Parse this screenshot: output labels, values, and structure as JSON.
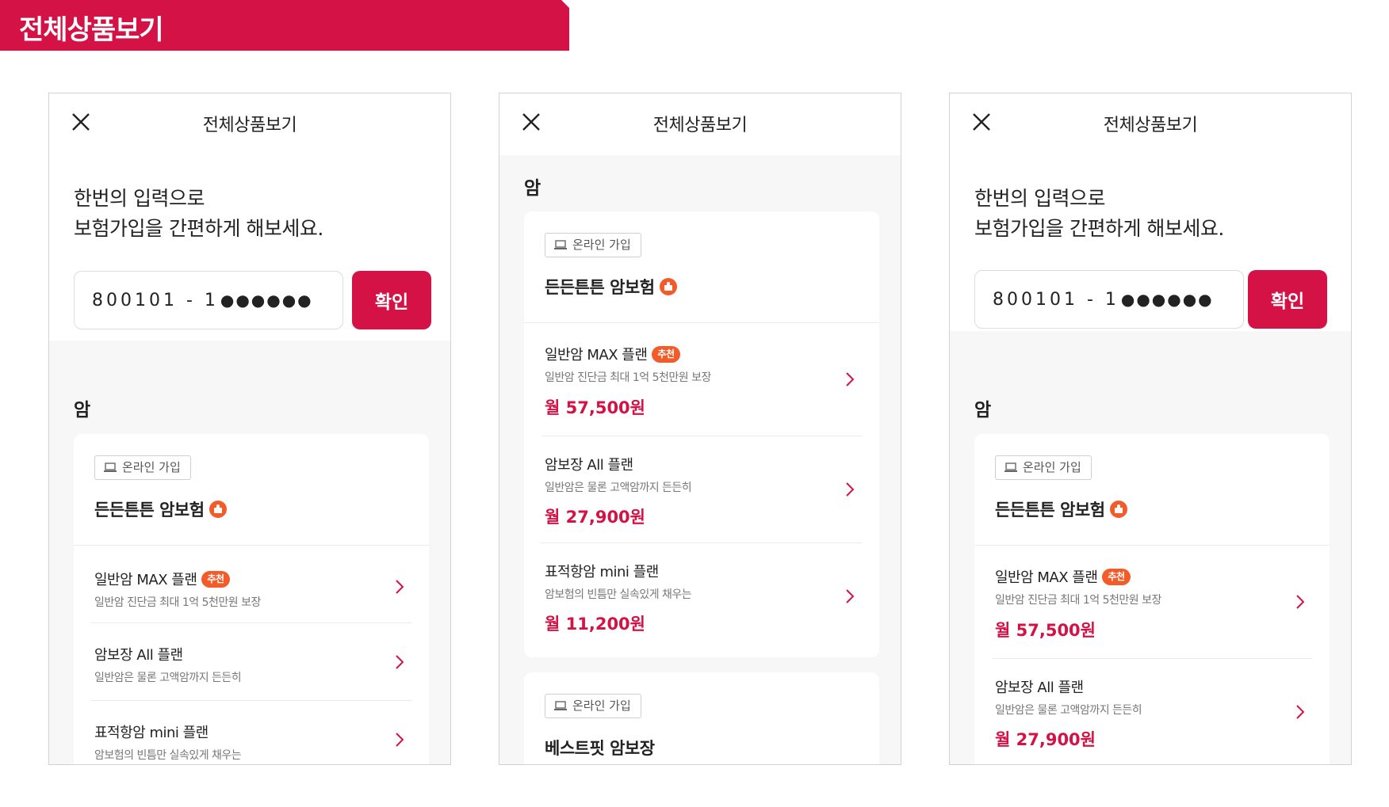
{
  "banner": {
    "title": "전체상품보기"
  },
  "common": {
    "nav_title": "전체상품보기",
    "hero_line1": "한번의 입력으로",
    "hero_line2": "보험가입을 간편하게 해보세요.",
    "id_front": "800101 - 1",
    "id_masked": "●●●●●●",
    "confirm_label": "확인",
    "category": "암",
    "online_badge": "온라인 가입",
    "recommend_badge": "추천"
  },
  "products": [
    {
      "name": "든든튼튼 암보험"
    },
    {
      "name": "베스트핏 암보장"
    }
  ],
  "plans": [
    {
      "name": "일반암 MAX 플랜",
      "desc": "일반암 진단금 최대 1억 5천만원 보장",
      "price": "월 57,500원",
      "recommended": true
    },
    {
      "name": "암보장 All 플랜",
      "desc": "일반암은 물론 고액암까지 든든히",
      "price": "월 27,900원",
      "recommended": false
    },
    {
      "name": "표적항암 mini 플랜",
      "desc": "암보험의 빈틈만 실속있게 채우는",
      "price": "월 11,200원",
      "recommended": false
    }
  ],
  "colors": {
    "brand": "#d41245",
    "badge": "#f25c2a",
    "background": "#f7f7f7"
  }
}
